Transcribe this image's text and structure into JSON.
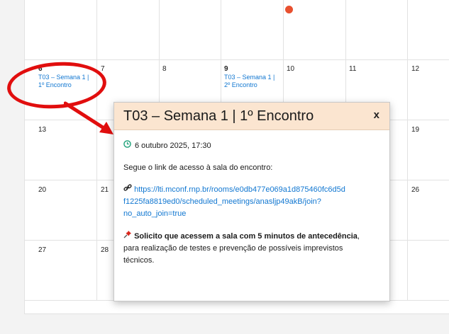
{
  "calendar": {
    "rows": [
      {
        "days": [
          "",
          "",
          "",
          "",
          "",
          "",
          ""
        ]
      },
      {
        "days": [
          "6",
          "7",
          "8",
          "9",
          "10",
          "11",
          "12"
        ]
      },
      {
        "days": [
          "13",
          "",
          "",
          "",
          "",
          "",
          "19"
        ]
      },
      {
        "days": [
          "20",
          "21",
          "",
          "",
          "",
          "",
          "26"
        ]
      },
      {
        "days": [
          "27",
          "28",
          "",
          "",
          "",
          "",
          ""
        ]
      }
    ],
    "events": {
      "day6": {
        "line1": "T03 – Semana 1 |",
        "line2": "1º Encontro"
      },
      "day9": {
        "line1": "T03 – Semana 1 |",
        "line2": "2º Encontro"
      }
    },
    "accent_color": "#1177d1",
    "today_color": "#e8502f"
  },
  "popover": {
    "title": "T03 – Semana 1 | 1º Encontro",
    "close_label": "x",
    "datetime": "6 outubro 2025, 17:30",
    "intro": "Segue o link de acesso à sala do encontro:",
    "link_line1": "https://lti.mconf.rnp.br/rooms/e0db477e069a1d875460fc6d5d",
    "link_line2": "f1225fa8819ed0/scheduled_meetings/anasljp49akB/join?",
    "link_line3": "no_auto_join=true",
    "notice_bold": "Solicito que acessem a sala com 5 minutos de antecedência",
    "notice_rest1": ",",
    "notice_rest2": "para realização de testes e prevenção de possíveis imprevistos",
    "notice_rest3": "técnicos.",
    "header_color": "#fbe5d0"
  },
  "icons": {
    "clock": "clock-icon",
    "link": "link-icon",
    "pin": "pushpin-icon"
  }
}
